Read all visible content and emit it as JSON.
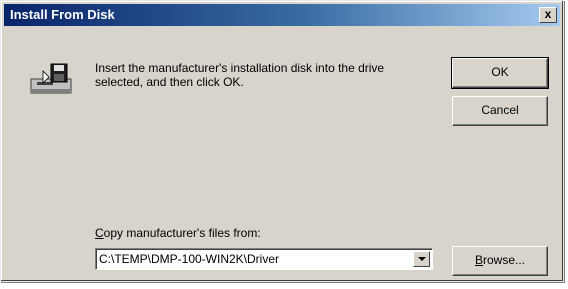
{
  "window": {
    "title": "Install From Disk",
    "close_glyph": "x"
  },
  "message": "Insert the manufacturer's installation disk into the drive selected, and then click OK.",
  "buttons": {
    "ok": "OK",
    "cancel": "Cancel",
    "browse_prefix": "B",
    "browse_rest": "rowse..."
  },
  "copy_from": {
    "label_prefix": "C",
    "label_rest": "opy manufacturer's files from:",
    "value": "C:\\TEMP\\DMP-100-WIN2K\\Driver"
  },
  "icons": {
    "disk": "floppy-disk-drive-icon",
    "dropdown": "chevron-down-icon"
  },
  "colors": {
    "titlebar_start": "#0a246a",
    "titlebar_end": "#a6caf0",
    "dialog_bg": "#d8d4cc"
  }
}
